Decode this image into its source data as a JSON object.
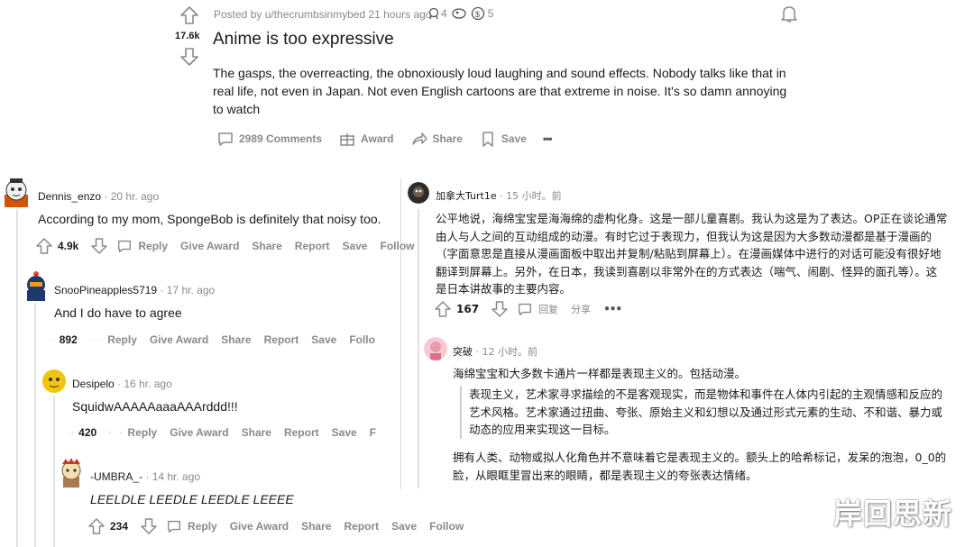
{
  "post": {
    "meta": "Posted by u/thecrumbsinmybed 21 hours ago",
    "award_counts": [
      "4",
      "5"
    ],
    "score": "17.6k",
    "title": "Anime is too expressive",
    "body": "The gasps, the overreacting, the obnoxiously loud laughing and sound effects. Nobody talks like that in real life, not even in Japan. Not even English cartoons are that extreme in noise. It's so damn annoying to watch",
    "comments_label": "2989 Comments",
    "award_label": "Award",
    "share_label": "Share",
    "save_label": "Save",
    "more_label": "•••"
  },
  "comments": [
    {
      "user": "Dennis_enzo",
      "time": "· 20 hr. ago",
      "text": "According to my mom, SpongeBob is definitely that noisy too.",
      "score": "4.9k",
      "actions": [
        "Reply",
        "Give Award",
        "Share",
        "Report",
        "Save",
        "Follow"
      ]
    },
    {
      "user": "SnooPineapples5719",
      "time": "· 17 hr. ago",
      "text": "And I do have to agree",
      "score": "892",
      "actions": [
        "Reply",
        "Give Award",
        "Share",
        "Report",
        "Save",
        "Follo"
      ]
    },
    {
      "user": "Desipelo",
      "time": "· 16 hr. ago",
      "text": "SquidwAAAAAaaaAAArddd!!!",
      "score": "420",
      "actions": [
        "Reply",
        "Give Award",
        "Share",
        "Report",
        "Save",
        "F"
      ]
    },
    {
      "user": "-UMBRA_-",
      "time": "· 14 hr. ago",
      "text": "LEELDLE LEEDLE LEEDLE LEEEE",
      "score": "234",
      "actions": [
        "Reply",
        "Give Award",
        "Share",
        "Report",
        "Save",
        "Follow"
      ]
    }
  ],
  "zh_comments": [
    {
      "user": "加拿大Turt1e",
      "time": "· 15 小时。前",
      "lines": [
        "公平地说，海绵宝宝是海海绵的虚构化身。这是一部儿童喜剧。我认为这是为了表达。OP正在谈论通常",
        "由人与人之间的互动组成的动漫。有时它过于表现力，但我认为这是因为大多数动漫都是基于漫画的",
        "（字面意思是直接从漫画面板中取出并复制/粘贴到屏幕上）。在漫画媒体中进行的对话可能没有很好地",
        "翻译到屏幕上。另外，在日本，我读到喜剧以非常外在的方式表达（喘气、闹剧、怪异的面孔等）。这",
        "是日本讲故事的主要内容。"
      ],
      "score": "167",
      "actions": [
        "回复",
        "分享"
      ]
    },
    {
      "user": "突破",
      "time": "· 12 小时。前",
      "intro": "海绵宝宝和大多数卡通片一样都是表现主义的。包括动漫。",
      "quote": [
        "表现主义，艺术家寻求描绘的不是客观现实，而是物体和事件在人体内引起的主观情感和反应的",
        "艺术风格。艺术家通过扭曲、夸张、原始主义和幻想以及通过形式元素的生动、不和谐、暴力或",
        "动态的应用来实现这一目标。"
      ],
      "outro": [
        "拥有人类、动物或拟人化角色并不意味着它是表现主义的。额头上的哈希标记，发呆的泡泡，0_0的",
        "脸，从眼眶里冒出来的眼睛，都是表现主义的夸张表达情绪。"
      ]
    }
  ],
  "watermark": "岸回思新"
}
